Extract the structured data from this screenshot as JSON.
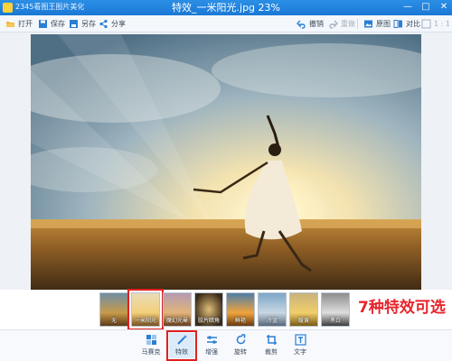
{
  "window": {
    "app_name": "2345看图王图片美化",
    "doc_title": "特效_一米阳光.jpg 23%",
    "controls": [
      "—",
      "□",
      "✕"
    ]
  },
  "toolbar": {
    "left": [
      {
        "icon": "folder-open-icon",
        "label": "打开"
      },
      {
        "icon": "save-icon",
        "label": "保存"
      },
      {
        "icon": "save-as-icon",
        "label": "另存"
      },
      {
        "icon": "share-icon",
        "label": "分享"
      }
    ],
    "right": [
      {
        "icon": "undo-icon",
        "label": "撤销",
        "enabled": true
      },
      {
        "icon": "redo-icon",
        "label": "重做",
        "enabled": false
      },
      {
        "icon": "original-image-icon",
        "label": "原图",
        "enabled": true
      },
      {
        "icon": "compare-icon",
        "label": "对比",
        "enabled": true
      },
      {
        "icon": "actual-size-icon",
        "label": "1 : 1",
        "enabled": false
      }
    ]
  },
  "filters": {
    "items": [
      {
        "label": "无",
        "selected": false
      },
      {
        "label": "一米阳光",
        "selected": true
      },
      {
        "label": "魔幻光晕",
        "selected": false
      },
      {
        "label": "胶片暗角",
        "selected": false
      },
      {
        "label": "鲜艳",
        "selected": false
      },
      {
        "label": "冷蓝",
        "selected": false
      },
      {
        "label": "暖黄",
        "selected": false
      },
      {
        "label": "黑白",
        "selected": false
      }
    ],
    "callout": "7种特效可选"
  },
  "bottom_tools": [
    {
      "icon": "mosaic-icon",
      "label": "马赛克",
      "active": false
    },
    {
      "icon": "magic-wand-icon",
      "label": "特效",
      "active": true
    },
    {
      "icon": "adjust-icon",
      "label": "增强",
      "active": false
    },
    {
      "icon": "rotate-icon",
      "label": "旋转",
      "active": false
    },
    {
      "icon": "crop-icon",
      "label": "裁剪",
      "active": false
    },
    {
      "icon": "text-icon",
      "label": "文字",
      "active": false
    }
  ],
  "colors": {
    "accent": "#1a78d4",
    "highlight": "#e02020",
    "icon_blue": "#2a7fd4"
  }
}
